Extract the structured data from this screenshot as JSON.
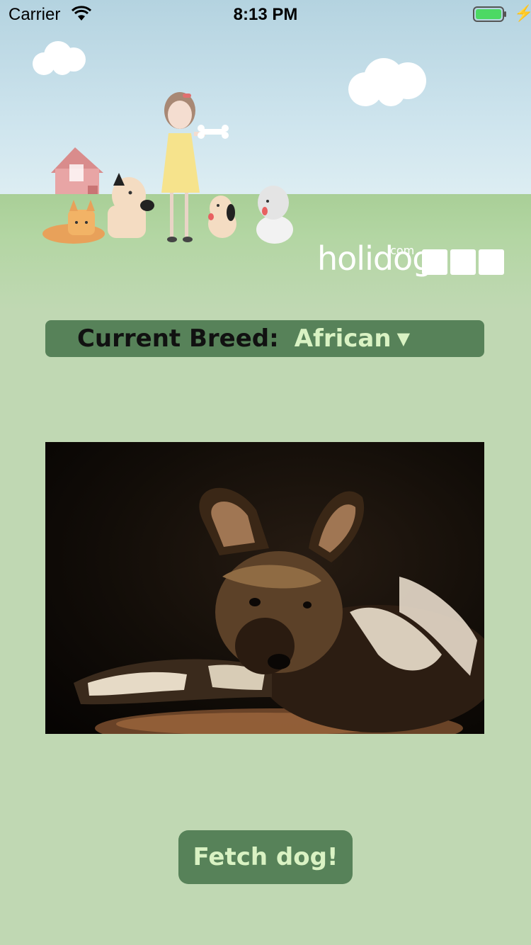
{
  "status_bar": {
    "carrier": "Carrier",
    "time": "8:13 PM",
    "battery_color": "#4cd964"
  },
  "header": {
    "logo_text": "holidog",
    "logo_suffix": ".com",
    "icons": [
      "cloud-icon",
      "house-icon",
      "girl-with-bone-icon",
      "dog-icon"
    ]
  },
  "breed_selector": {
    "label": "Current Breed:",
    "value": "African",
    "caret": "▼"
  },
  "photo": {
    "subject": "african-wild-dog"
  },
  "fetch_button": {
    "label": "Fetch dog!"
  },
  "colors": {
    "background": "#c0d8b3",
    "accent": "#578259",
    "accent_text": "#d9f2c3"
  }
}
